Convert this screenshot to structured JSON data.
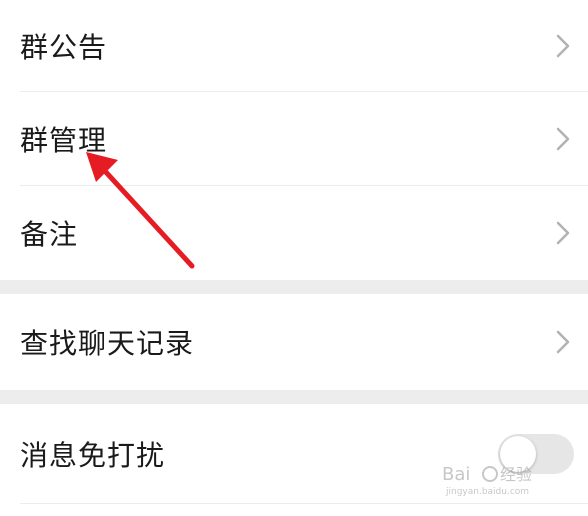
{
  "settings": {
    "group_1": [
      {
        "label": "群公告"
      },
      {
        "label": "群管理"
      },
      {
        "label": "备注"
      }
    ],
    "search_history": {
      "label": "查找聊天记录"
    },
    "mute": {
      "label": "消息免打扰",
      "enabled": false
    }
  },
  "watermark": {
    "brand": "Baidu经验",
    "url": "jingyan.baidu.com"
  },
  "colors": {
    "section_gap": "#ededed",
    "divider": "#ececec",
    "chevron": "#b2b2b2",
    "annotation_arrow": "#e51c23",
    "toggle_off": "#e6e6e6"
  },
  "icons": {
    "chevron": "chevron-right-icon",
    "annotation": "red-arrow-annotation"
  }
}
